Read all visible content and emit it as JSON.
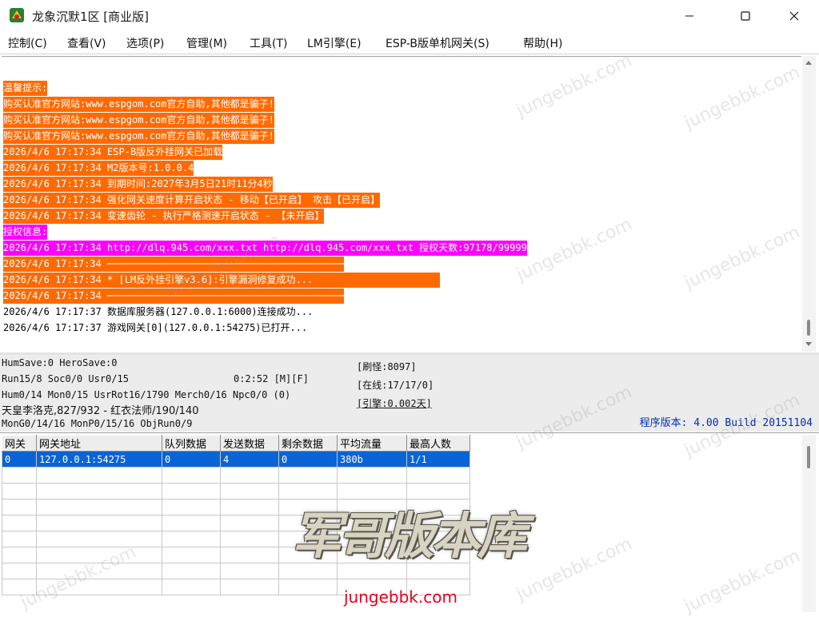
{
  "window": {
    "title": "龙象沉默1区 [商业版]",
    "minimize_icon": "minimize-icon",
    "maximize_icon": "maximize-icon",
    "close_icon": "close-icon"
  },
  "menu": [
    {
      "label": "控制(C)"
    },
    {
      "label": "查看(V)"
    },
    {
      "label": "选项(P)"
    },
    {
      "label": "管理(M)"
    },
    {
      "label": "工具(T)"
    },
    {
      "label": "LM引擎(E)"
    },
    {
      "label": "ESP-B版单机网关(S)"
    },
    {
      "label": "帮助(H)"
    }
  ],
  "log": [
    {
      "text": "温馨提示:",
      "style": "orange"
    },
    {
      "text": "购买认准官方网站:www.espgom.com官方自助,其他都是骗子!",
      "style": "orange"
    },
    {
      "text": "购买认准官方网站:www.espgom.com官方自助,其他都是骗子!",
      "style": "orange"
    },
    {
      "text": "购买认准官方网站:www.espgom.com官方自助,其他都是骗子!",
      "style": "orange"
    },
    {
      "text": "2026/4/6 17:17:34 ESP-B版反外挂网关已加载",
      "style": "orange"
    },
    {
      "text": "2026/4/6 17:17:34 M2版本号:1.0.0.4",
      "style": "orange"
    },
    {
      "text": "2026/4/6 17:17:34 到期时间:2027年3月5日21时11分4秒",
      "style": "orange"
    },
    {
      "text": "2026/4/6 17:17:34 强化网关速度计算开启状态 - 移动【已开启】 攻击【已开启】",
      "style": "orange"
    },
    {
      "text": "2026/4/6 17:17:34 变速齿轮 - 执行严格测速开启状态 - 【未开启】",
      "style": "orange"
    },
    {
      "text": "授权信息:",
      "style": "magenta"
    },
    {
      "text": "2026/4/6 17:17:34 http://dlq.945.com/xxx.txt http://dlq.945.com/xxx.txt 授权天数:97178/99999",
      "style": "magenta"
    },
    {
      "text": "2026/4/6 17:17:34 ─────────────────────────────────────────",
      "style": "orange"
    },
    {
      "text": "2026/4/6 17:17:34 * [LM反外挂引擎v3.6]:引擎漏洞修复成功...                      ",
      "style": "orange"
    },
    {
      "text": "2026/4/6 17:17:34 ─────────────────────────────────────────",
      "style": "orange"
    },
    {
      "text": "2026/4/6 17:17:37 数据库服务器(127.0.0.1:6000)连接成功...",
      "style": "normal"
    },
    {
      "text": "2026/4/6 17:17:37 游戏网关[0](127.0.0.1:54275)已打开...",
      "style": "normal"
    }
  ],
  "status": {
    "line1": "HumSave:0 HeroSave:0",
    "line2": "Run15/8 Soc0/0 Usr0/15",
    "timer": "0:2:52 [M][F]",
    "line3": "Hum0/14 Mon0/15 UsrRot16/1790 Merch0/16 Npc0/0 (0)",
    "line4": "天皇李洛克,827/932 - 红衣法师/190/140",
    "line5": "MonG0/14/16 MonP0/15/16 ObjRun0/9",
    "refresh": "[刷怪:8097]",
    "online": "[在线:17/17/0]",
    "engine": "[引擎:0.002天]",
    "version": "程序版本: 4.00 Build 20151104"
  },
  "grid": {
    "headers": [
      "网关",
      "网关地址",
      "队列数据",
      "发送数据",
      "剩余数据",
      "平均流量",
      "最高人数"
    ],
    "rows": [
      [
        "0",
        "127.0.0.1:54275",
        "0",
        "4",
        "0",
        "380b",
        "1/1"
      ]
    ],
    "empty_rows": 8
  },
  "watermark": {
    "logo_text": "军哥版本库",
    "site": "jungebbk.com",
    "diagonal": "jungebbk.com"
  },
  "colors": {
    "highlight_orange": "#ff6a00",
    "highlight_magenta": "#ff00ff",
    "selection": "#0a64d6",
    "version_text": "#0030b0"
  }
}
